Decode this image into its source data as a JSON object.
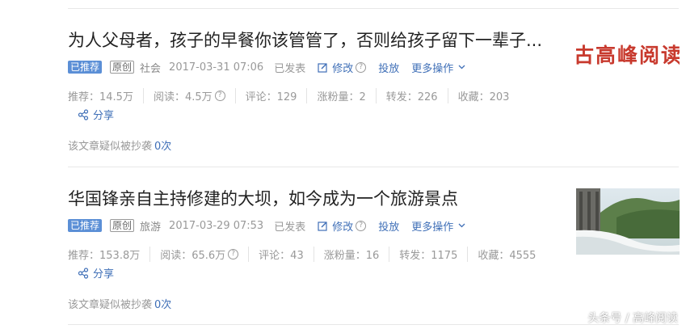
{
  "articles": [
    {
      "title": "为人父母者，孩子的早餐你该管管了，否则给孩子留下一辈子...",
      "badge_recommended": "已推荐",
      "badge_original": "原创",
      "category": "社会",
      "date": "2017-03-31 07:06",
      "status": "已发表",
      "edit": "修改",
      "publish": "投放",
      "more": "更多操作",
      "stats": {
        "recommend": "推荐：14.5万",
        "read": "阅读：4.5万",
        "comments": "评论：129",
        "followers": "涨粉量：2",
        "reposts": "转发：226",
        "favorites": "收藏：203"
      },
      "share": "分享",
      "plagiarism_label": "该文章疑似被抄袭",
      "plagiarism_count": "0次",
      "thumbnail_text": "古高峰阅读"
    },
    {
      "title": "华国锋亲自主持修建的大坝，如今成为一个旅游景点",
      "badge_recommended": "已推荐",
      "badge_original": "原创",
      "category": "旅游",
      "date": "2017-03-29 07:53",
      "status": "已发表",
      "edit": "修改",
      "publish": "投放",
      "more": "更多操作",
      "stats": {
        "recommend": "推荐：153.8万",
        "read": "阅读：65.6万",
        "comments": "评论：43",
        "followers": "涨粉量：16",
        "reposts": "转发：1175",
        "favorites": "收藏：4555"
      },
      "share": "分享",
      "plagiarism_label": "该文章疑似被抄袭",
      "plagiarism_count": "0次"
    }
  ],
  "watermark": "头条号 / 高峰阅读",
  "colors": {
    "link": "#3f6fb7",
    "badge": "#5b8fd6",
    "thumb_text": "#c83a2e"
  }
}
